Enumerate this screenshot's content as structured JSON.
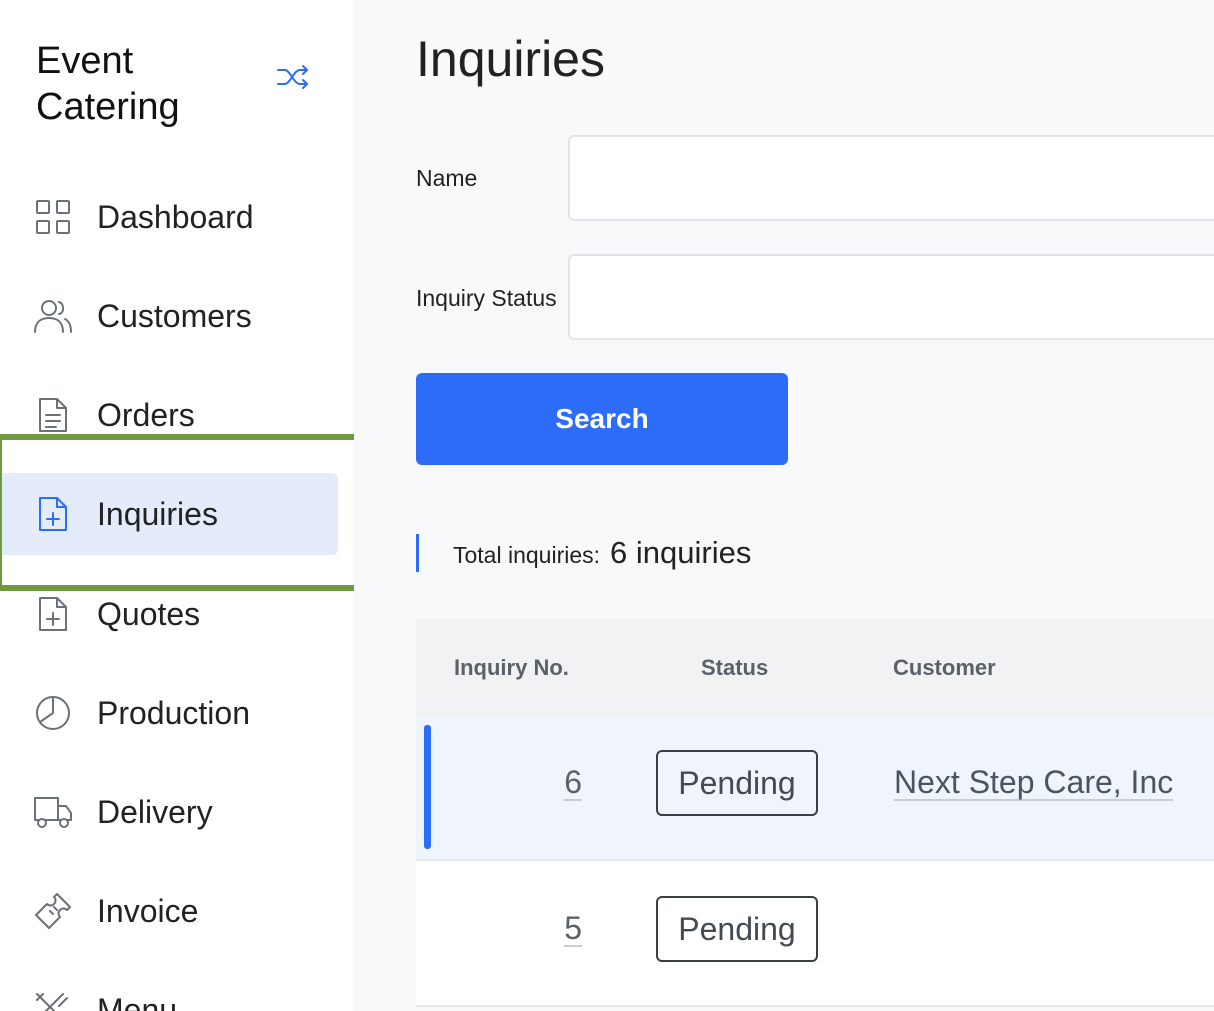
{
  "app": {
    "title_line1": "Event",
    "title_line2": "Catering"
  },
  "sidebar": {
    "items": [
      {
        "label": "Dashboard",
        "icon": "grid-icon"
      },
      {
        "label": "Customers",
        "icon": "users-icon"
      },
      {
        "label": "Orders",
        "icon": "document-icon"
      },
      {
        "label": "Inquiries",
        "icon": "file-plus-icon",
        "active": true
      },
      {
        "label": "Quotes",
        "icon": "file-plus-icon"
      },
      {
        "label": "Production",
        "icon": "pie-chart-icon"
      },
      {
        "label": "Delivery",
        "icon": "truck-icon"
      },
      {
        "label": "Invoice",
        "icon": "ticket-icon"
      },
      {
        "label": "Menu",
        "icon": "utensils-icon"
      }
    ]
  },
  "main": {
    "title": "Inquiries",
    "filters": {
      "name_label": "Name",
      "name_value": "",
      "status_label": "Inquiry Status",
      "status_value": ""
    },
    "search_label": "Search",
    "total_label": "Total inquiries:",
    "total_value": "6 inquiries",
    "table": {
      "headers": [
        "Inquiry No.",
        "Status",
        "Customer"
      ],
      "rows": [
        {
          "no": "6",
          "status": "Pending",
          "customer": "Next Step Care, Inc"
        },
        {
          "no": "5",
          "status": "Pending",
          "customer": ""
        }
      ]
    }
  },
  "colors": {
    "accent": "#2d6cf6",
    "highlight": "#6f9a40",
    "active_bg": "#e4ebfb"
  }
}
